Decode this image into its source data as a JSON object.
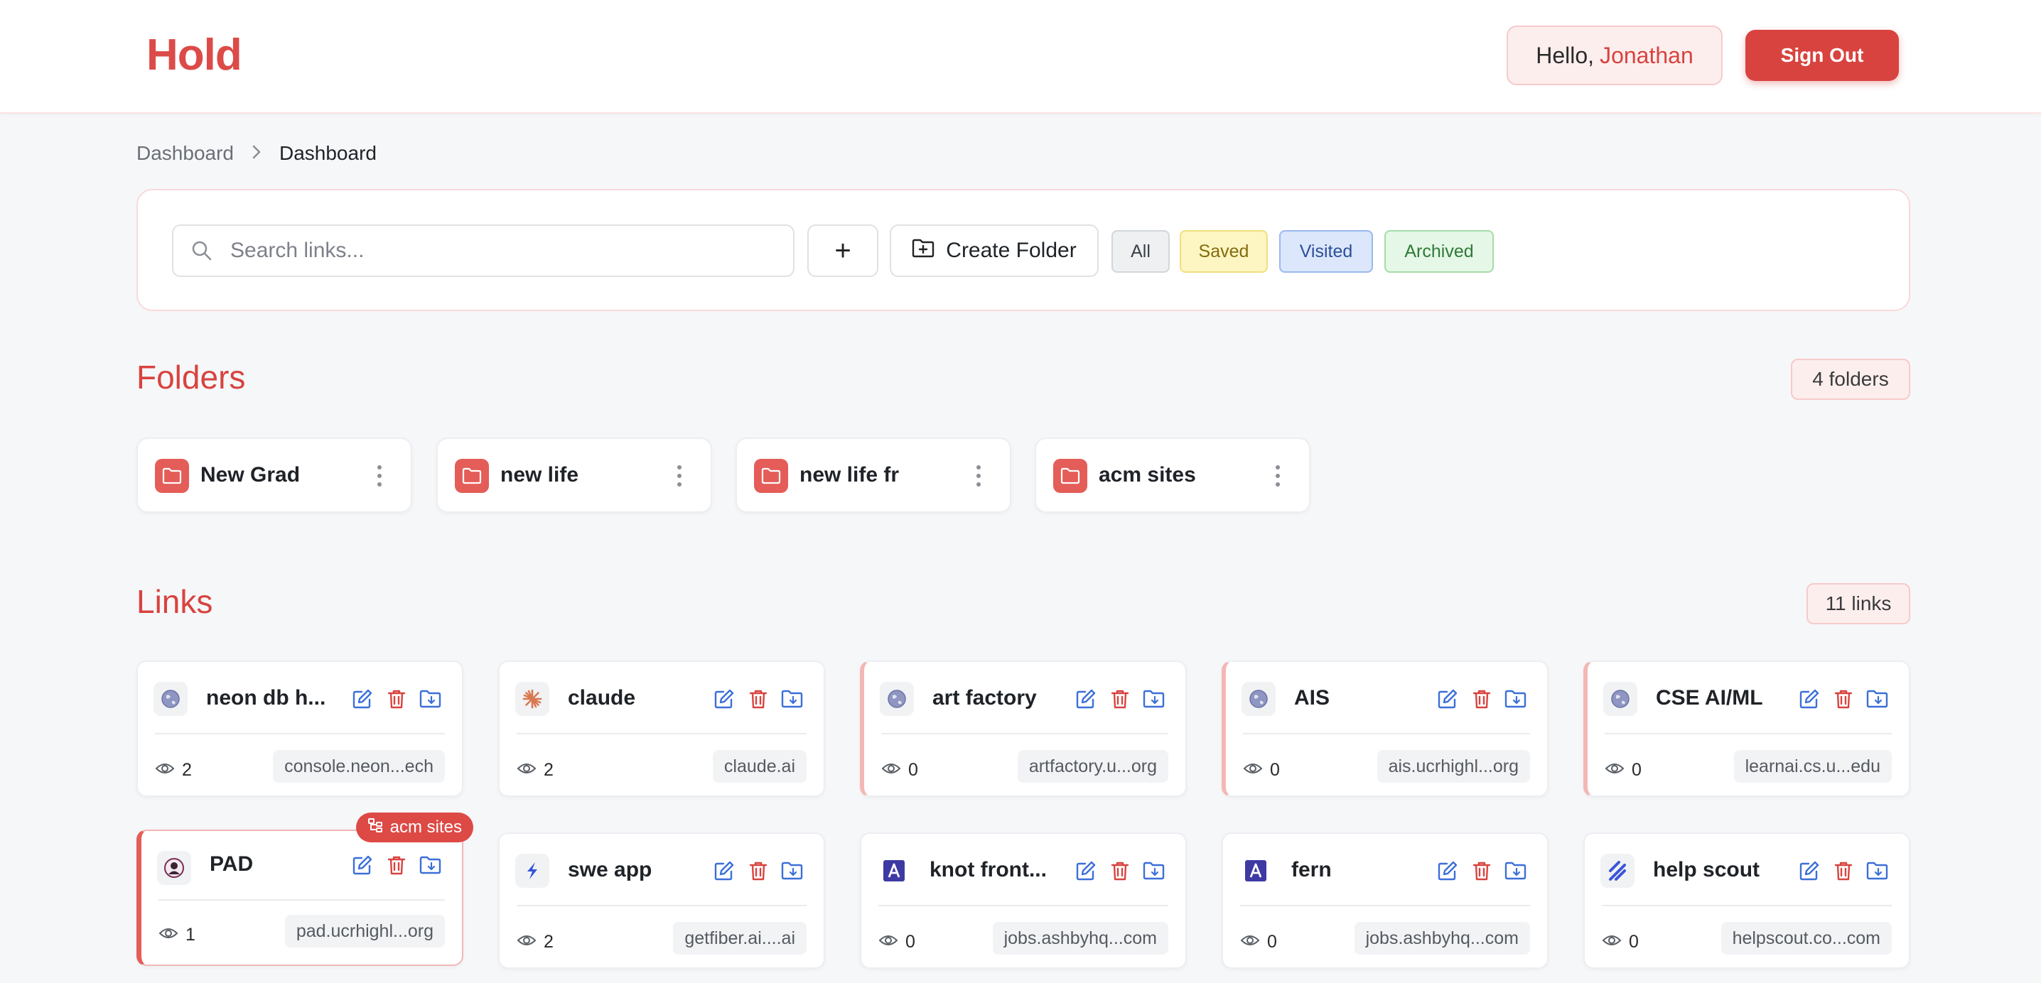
{
  "app": {
    "logo": "Hold"
  },
  "header": {
    "greeting": "Hello,",
    "user_name": "Jonathan",
    "signout_label": "Sign Out"
  },
  "breadcrumb": {
    "items": [
      "Dashboard",
      "Dashboard"
    ]
  },
  "toolbar": {
    "search_placeholder": "Search links...",
    "add_label": "+",
    "create_folder_label": "Create Folder",
    "filters": [
      "All",
      "Saved",
      "Visited",
      "Archived"
    ]
  },
  "folders": {
    "title": "Folders",
    "count_label": "4 folders",
    "items": [
      {
        "name": "New Grad"
      },
      {
        "name": "new life"
      },
      {
        "name": "new life fr"
      },
      {
        "name": "acm sites"
      }
    ]
  },
  "links": {
    "title": "Links",
    "count_label": "11 links",
    "items": [
      {
        "title": "neon db h...",
        "views": "2",
        "domain": "console.neon...ech",
        "icon": "globe-icon"
      },
      {
        "title": "claude",
        "views": "2",
        "domain": "claude.ai",
        "icon": "claude-starburst-icon"
      },
      {
        "title": "art factory",
        "views": "0",
        "domain": "artfactory.u...org",
        "icon": "globe-icon"
      },
      {
        "title": "AIS",
        "views": "0",
        "domain": "ais.ucrhighl...org",
        "icon": "globe-icon"
      },
      {
        "title": "CSE AI/ML",
        "views": "0",
        "domain": "learnai.cs.u...edu",
        "icon": "globe-icon"
      },
      {
        "title": "PAD",
        "views": "1",
        "domain": "pad.ucrhighl...org",
        "icon": "pad-seal-icon",
        "folder_tag": "acm sites"
      },
      {
        "title": "swe app",
        "views": "2",
        "domain": "getfiber.ai....ai",
        "icon": "fiber-bolt-icon"
      },
      {
        "title": "knot front...",
        "views": "0",
        "domain": "jobs.ashbyhq...com",
        "icon": "ashby-a-icon"
      },
      {
        "title": "fern",
        "views": "0",
        "domain": "jobs.ashbyhq...com",
        "icon": "ashby-a-icon"
      },
      {
        "title": "help scout",
        "views": "0",
        "domain": "helpscout.co...com",
        "icon": "helpscout-stripes-icon"
      }
    ]
  },
  "colors": {
    "accent": "#d8433f",
    "folder_icon": "#e45d58",
    "edit": "#3b6fd8",
    "delete": "#d8433f"
  }
}
